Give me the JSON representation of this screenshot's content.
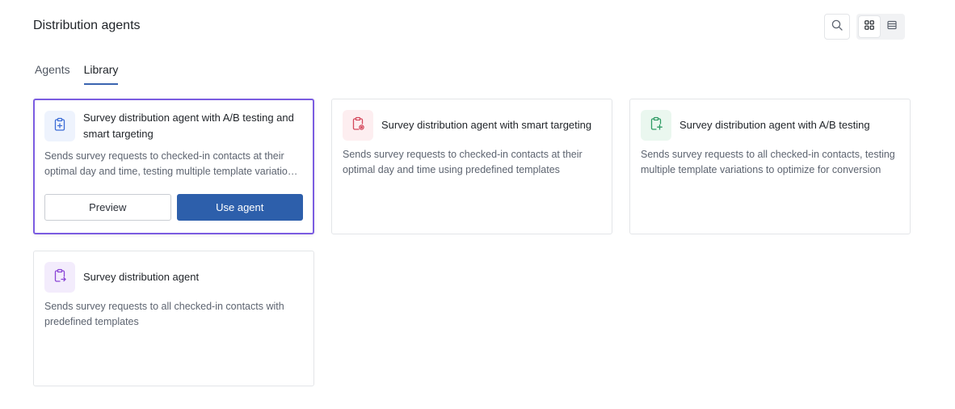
{
  "page": {
    "title": "Distribution agents"
  },
  "toolbar": {
    "search_icon": "search-icon",
    "grid_view_icon": "grid-view-icon",
    "list_view_icon": "list-view-icon",
    "active_view": "grid"
  },
  "tabs": [
    {
      "label": "Agents",
      "active": false
    },
    {
      "label": "Library",
      "active": true
    }
  ],
  "colors": {
    "accent": "#2d5fab",
    "selected_border": "#7b5ce1",
    "tab_underline": "#3a64b0"
  },
  "cards": [
    {
      "title": "Survey distribution agent with A/B testing and smart targeting",
      "description": "Sends survey requests to checked-in contacts at their optimal day and time, testing multiple template variations to optimize for conversion",
      "icon": "clipboard-plus-icon",
      "icon_color": "#3b6bd6",
      "icon_bg": "#eef3fd",
      "selected": true,
      "preview_label": "Preview",
      "use_label": "Use agent"
    },
    {
      "title": "Survey distribution agent with smart targeting",
      "description": "Sends survey requests to checked-in contacts at their optimal day and time using predefined templates",
      "icon": "clipboard-target-icon",
      "icon_color": "#d4475b",
      "icon_bg": "#fdeef0",
      "selected": false
    },
    {
      "title": "Survey distribution agent with A/B testing",
      "description": "Sends survey requests to all checked-in contacts, testing multiple template variations to optimize for conversion",
      "icon": "clipboard-plus-icon",
      "icon_color": "#2e9b64",
      "icon_bg": "#eaf7ef",
      "selected": false
    },
    {
      "title": "Survey distribution agent",
      "description": "Sends survey requests to all checked-in contacts with predefined templates",
      "icon": "clipboard-send-icon",
      "icon_color": "#8a45d6",
      "icon_bg": "#f3ecfc",
      "selected": false
    }
  ]
}
